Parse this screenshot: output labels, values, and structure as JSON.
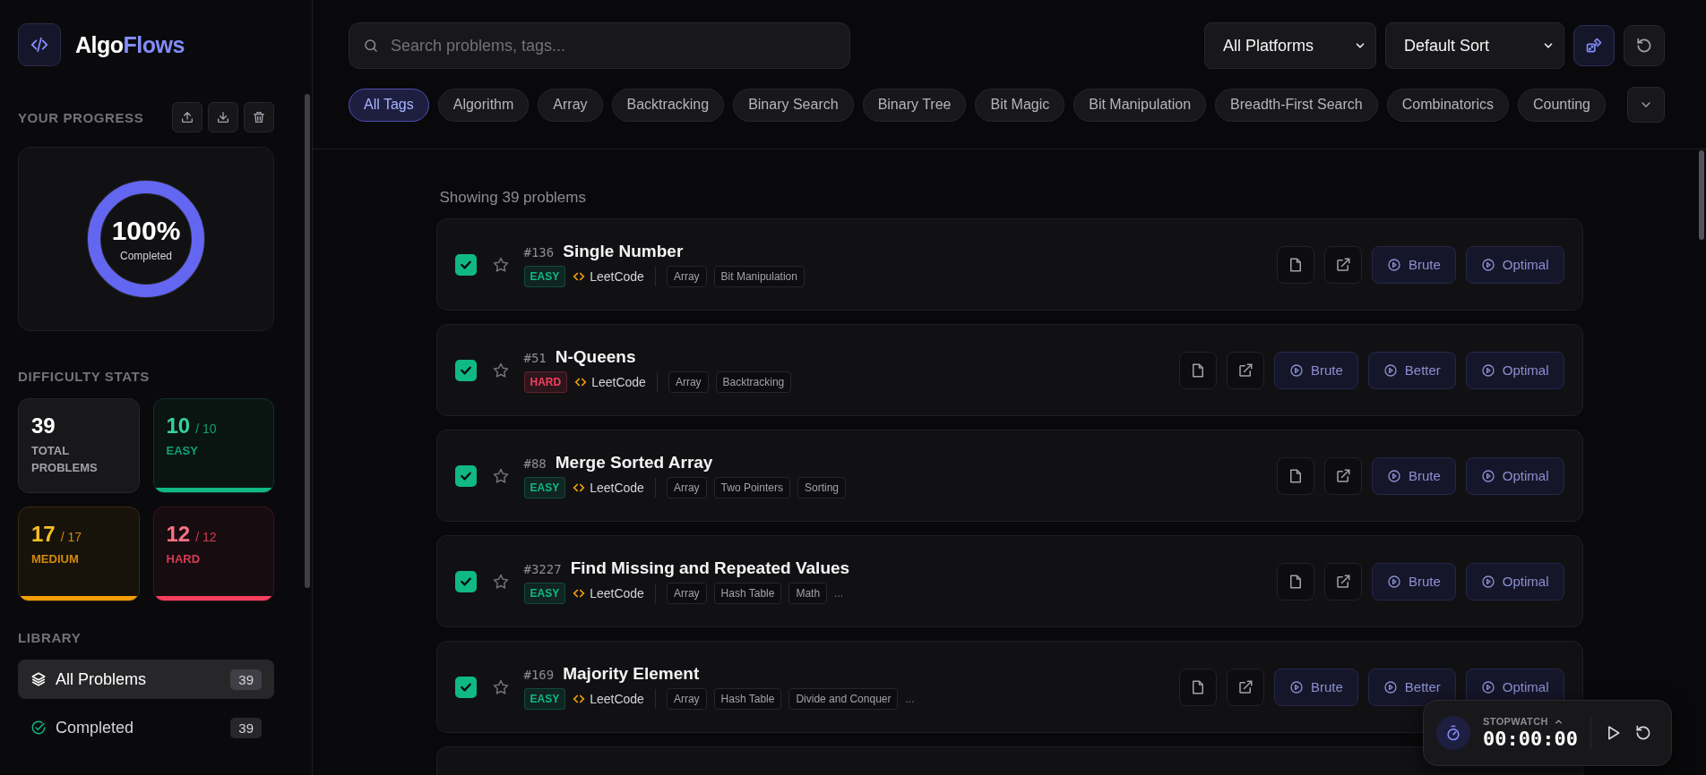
{
  "sidebar": {
    "logo": {
      "text": "Algo",
      "accent": "Flows"
    },
    "progress": {
      "heading": "YOUR PROGRESS",
      "percent": "100%",
      "caption": "Completed",
      "level": 1
    },
    "stats_heading": "DIFFICULTY STATS",
    "stats": [
      {
        "kind": "total",
        "value": "39",
        "label": "TOTAL PROBLEMS"
      },
      {
        "kind": "easy",
        "value": "10",
        "total": "/ 10",
        "label": "EASY",
        "level": 1
      },
      {
        "kind": "medium",
        "value": "17",
        "total": "/ 17",
        "label": "MEDIUM",
        "level": 1
      },
      {
        "kind": "hard",
        "value": "12",
        "total": "/ 12",
        "label": "HARD",
        "level": 1
      }
    ],
    "library_heading": "LIBRARY",
    "library": [
      {
        "kind": "all",
        "label": "All Problems",
        "count": "39",
        "selected": true
      },
      {
        "kind": "completed",
        "label": "Completed",
        "count": "39",
        "selected": false
      }
    ]
  },
  "toolbar": {
    "search": {
      "placeholder": "Search problems, tags..."
    },
    "platform": "All Platforms",
    "sort": "Default Sort"
  },
  "tags": [
    {
      "label": "All Tags",
      "selected": true
    },
    {
      "label": "Algorithm",
      "selected": false
    },
    {
      "label": "Array",
      "selected": false
    },
    {
      "label": "Backtracking",
      "selected": false
    },
    {
      "label": "Binary Search",
      "selected": false
    },
    {
      "label": "Binary Tree",
      "selected": false
    },
    {
      "label": "Bit Magic",
      "selected": false
    },
    {
      "label": "Bit Manipulation",
      "selected": false
    },
    {
      "label": "Breadth-First Search",
      "selected": false
    },
    {
      "label": "Combinatorics",
      "selected": false
    },
    {
      "label": "Counting",
      "selected": false
    }
  ],
  "list": {
    "summary": "Showing 39 problems",
    "problems": [
      {
        "number": "#136",
        "title": "Single Number",
        "difficulty": {
          "kind": "easy",
          "label": "EASY"
        },
        "platform": "LeetCode",
        "tags": [
          "Array",
          "Bit Manipulation"
        ],
        "checked": true,
        "starred": false,
        "solutions": [
          "Brute",
          "Optimal"
        ]
      },
      {
        "number": "#51",
        "title": "N-Queens",
        "difficulty": {
          "kind": "hard",
          "label": "HARD"
        },
        "platform": "LeetCode",
        "tags": [
          "Array",
          "Backtracking"
        ],
        "checked": true,
        "starred": false,
        "solutions": [
          "Brute",
          "Better",
          "Optimal"
        ]
      },
      {
        "number": "#88",
        "title": "Merge Sorted Array",
        "difficulty": {
          "kind": "easy",
          "label": "EASY"
        },
        "platform": "LeetCode",
        "tags": [
          "Array",
          "Two Pointers",
          "Sorting"
        ],
        "checked": true,
        "starred": false,
        "solutions": [
          "Brute",
          "Optimal"
        ]
      },
      {
        "number": "#3227",
        "title": "Find Missing and Repeated Values",
        "difficulty": {
          "kind": "easy",
          "label": "EASY"
        },
        "platform": "LeetCode",
        "tags": [
          "Array",
          "Hash Table",
          "Math"
        ],
        "more": "...",
        "checked": true,
        "starred": false,
        "solutions": [
          "Brute",
          "Optimal"
        ]
      },
      {
        "number": "#169",
        "title": "Majority Element",
        "difficulty": {
          "kind": "easy",
          "label": "EASY"
        },
        "platform": "LeetCode",
        "tags": [
          "Array",
          "Hash Table",
          "Divide and Conquer"
        ],
        "more": "...",
        "checked": true,
        "starred": false,
        "solutions": [
          "Brute",
          "Better",
          "Optimal"
        ]
      }
    ]
  },
  "stopwatch": {
    "label": "STOPWATCH",
    "time": "00:00:00"
  }
}
